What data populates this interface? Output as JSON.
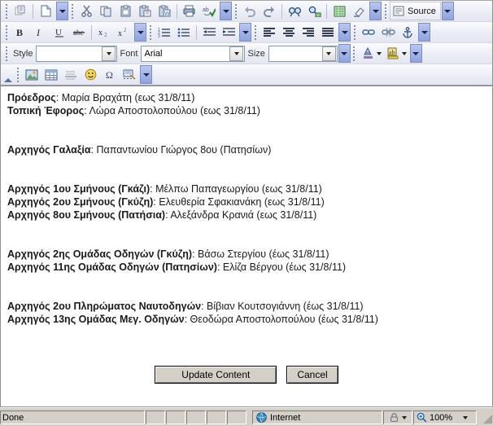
{
  "toolbar": {
    "rows": [
      {
        "groups": [
          {
            "buttons": [
              "copy-format-icon"
            ]
          },
          {
            "buttons": [
              "new-page-icon"
            ],
            "arrow": true
          },
          {
            "buttons": [
              "cut-icon",
              "copy-icon",
              "paste-icon",
              "paste-text-icon",
              "paste-word-icon"
            ]
          },
          {
            "buttons": [
              "print-icon",
              "spellcheck-icon"
            ],
            "arrow": true
          },
          {
            "buttons": [
              "undo-icon",
              "redo-icon"
            ]
          },
          {
            "buttons": [
              "find-icon",
              "replace-icon"
            ]
          },
          {
            "buttons": [
              "select-all-icon",
              "remove-format-icon"
            ],
            "arrow": true
          },
          {
            "source_label": "Source",
            "arrow": true
          }
        ]
      },
      {
        "groups": [
          {
            "buttons": [
              "bold-icon",
              "italic-icon",
              "underline-icon",
              "strikethrough-icon"
            ]
          },
          {
            "buttons": [
              "subscript-icon",
              "superscript-icon"
            ],
            "arrow": true
          },
          {
            "buttons": [
              "numbered-list-icon",
              "bulleted-list-icon"
            ]
          },
          {
            "buttons": [
              "outdent-icon",
              "indent-icon"
            ],
            "arrow": true
          },
          {
            "buttons": [
              "align-left-icon",
              "align-center-icon",
              "align-right-icon",
              "align-justify-icon"
            ],
            "arrow": true
          },
          {
            "buttons": [
              "link-icon",
              "unlink-icon",
              "anchor-icon"
            ],
            "arrow": true
          }
        ]
      },
      {
        "style_label": "Style",
        "style_value": "",
        "font_label": "Font",
        "font_value": "Arial",
        "size_label": "Size",
        "size_value": "",
        "groups": [
          {
            "buttons": [
              "text-color-icon",
              "background-color-icon"
            ],
            "arrow": true
          }
        ]
      },
      {
        "groups": [
          {
            "buttons": [
              "image-icon",
              "table-icon",
              "horizontal-rule-icon",
              "smiley-icon",
              "special-char-icon",
              "page-break-icon"
            ],
            "arrow": true
          }
        ]
      }
    ]
  },
  "document": {
    "blocks": [
      {
        "lines": [
          {
            "label": "Πρόεδρος",
            "text": ": Μαρία Βραχάτη (εως 31/8/11)"
          },
          {
            "label": "Τοπική Έφορος",
            "text": ": Λώρα Αποστολοπούλου (εως 31/8/11)"
          }
        ]
      },
      {
        "lines": [
          {
            "label": "Αρχηγός Γαλαξία",
            "text": ": Παπαντωνίου Γιώργος   8ου (Πατησίων)"
          }
        ]
      },
      {
        "lines": [
          {
            "label": "Αρχηγός 1ου Σμήνους (Γκάζι)",
            "text": ": Μέλπω Παπαγεωργίου (εως 31/8/11)"
          },
          {
            "label": "Αρχηγός 2ου Σμήνους (Γκύζη)",
            "text": ": Ελευθερία Σφακιανάκη (εως 31/8/11)"
          },
          {
            "label": "Αρχηγός 8ου Σμήνους (Πατήσια)",
            "text": ": Αλεξάνδρα Κρανιά (εως 31/8/11)"
          }
        ]
      },
      {
        "lines": [
          {
            "label": "Αρχηγός 2ης Ομάδας Οδηγών (Γκύζη)",
            "text": ": Βάσω Στεργίου (έως 31/8/11)"
          },
          {
            "label": "Αρχηγός 11ης Ομάδας Οδηγών (Πατησίων)",
            "text": ": Ελίζα Βέργου (έως 31/8/11)"
          }
        ]
      },
      {
        "lines": [
          {
            "label": "Αρχηγός 2ου Πληρώματος Ναυτοδηγών",
            "text": ": Βίβιαν Κουτσογιάννη (έως 31/8/11)"
          },
          {
            "label": "Αρχηγός 13ης Ομάδας Μεγ. Οδηγών",
            "text": ": Θεοδώρα Αποστολοπούλου (έως 31/8/11)"
          }
        ]
      }
    ]
  },
  "actions": {
    "update_label": "Update Content",
    "cancel_label": "Cancel"
  },
  "status": {
    "message": "Done",
    "zone": "Internet",
    "zoom": "100%"
  },
  "colors": {
    "toolbar_bg": "#eef0f7",
    "dropdown_blue": "#8fa3dd",
    "status_bg": "#d4d0c8",
    "text": "#1a1a1a"
  }
}
